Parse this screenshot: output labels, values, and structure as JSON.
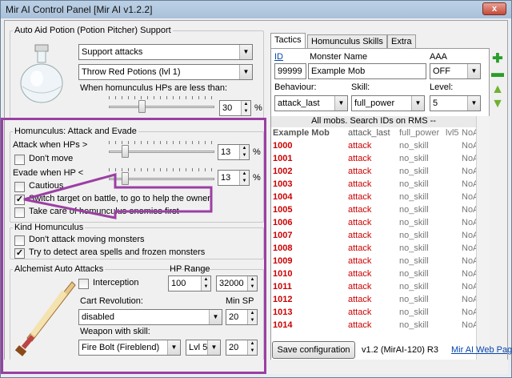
{
  "window": {
    "title": "Mir AI Control Panel [Mir AI v1.2.2]",
    "close": "x"
  },
  "potion": {
    "legend": "Auto Aid Potion (Potion Pitcher) Support",
    "mode": "Support attacks",
    "potion": "Throw Red Potions (lvl 1)",
    "hp_label": "When homunculus HPs are less than:",
    "hp_value": "30",
    "hp_unit": "%",
    "hp_slider_fraction": 0.3
  },
  "attack_evade": {
    "legend": "Homunculus: Attack and Evade",
    "attack_label": "Attack when HPs >",
    "attack_value": "13",
    "attack_unit": "%",
    "attack_slider_fraction": 0.13,
    "dont_move": "Don't move",
    "dont_move_checked": false,
    "evade_label": "Evade when HP <",
    "evade_value": "13",
    "evade_unit": "%",
    "evade_slider_fraction": 0.13,
    "cautious": "Cautious",
    "cautious_checked": false,
    "switch_target": "Switch target on battle, to go to help the owner",
    "switch_target_checked": true,
    "take_care": "Take care of homunculus enemies first",
    "take_care_checked": false
  },
  "kind": {
    "legend": "Kind Homunculus",
    "dont_attack": "Don't attack moving monsters",
    "dont_attack_checked": false,
    "detect_area": "Try to detect area spells and frozen monsters",
    "detect_area_checked": true
  },
  "alchemist": {
    "legend": "Alchemist Auto Attacks",
    "interception": "Interception",
    "interception_checked": false,
    "hp_range_label": "HP Range",
    "hp_min": "100",
    "hp_max": "32000",
    "cart_label": "Cart Revolution:",
    "cart_value": "disabled",
    "min_sp_label": "Min SP",
    "cart_min_sp": "20",
    "weapon_label": "Weapon with skill:",
    "weapon_value": "Fire Bolt (Fireblend)",
    "weapon_level": "Lvl 5",
    "weapon_min_sp": "20"
  },
  "tabs": [
    {
      "label": "Tactics"
    },
    {
      "label": "Homunculus Skills"
    },
    {
      "label": "Extra"
    }
  ],
  "tactics": {
    "id_label": "ID",
    "name_label": "Monster Name",
    "aaa_label": "AAA",
    "id_value": "99999",
    "name_value": "Example Mob",
    "aaa_value": "OFF",
    "behaviour_label": "Behaviour:",
    "skill_label": "Skill:",
    "level_label": "Level:",
    "behaviour_value": "attack_last",
    "skill_value": "full_power",
    "level_value": "5",
    "list_caption": "All mobs. Search IDs on RMS --",
    "header_row": {
      "name": "Example Mob",
      "behaviour": "attack_last",
      "skill": "full_power",
      "level": "lvl5",
      "aaa": "NoAAA"
    },
    "rows": [
      {
        "id": "1000",
        "behaviour": "attack",
        "skill": "no_skill",
        "aaa": "NoAAA"
      },
      {
        "id": "1001",
        "behaviour": "attack",
        "skill": "no_skill",
        "aaa": "NoAAA"
      },
      {
        "id": "1002",
        "behaviour": "attack",
        "skill": "no_skill",
        "aaa": "NoAAA"
      },
      {
        "id": "1003",
        "behaviour": "attack",
        "skill": "no_skill",
        "aaa": "NoAAA"
      },
      {
        "id": "1004",
        "behaviour": "attack",
        "skill": "no_skill",
        "aaa": "NoAAA"
      },
      {
        "id": "1005",
        "behaviour": "attack",
        "skill": "no_skill",
        "aaa": "NoAAA"
      },
      {
        "id": "1006",
        "behaviour": "attack",
        "skill": "no_skill",
        "aaa": "NoAAA"
      },
      {
        "id": "1007",
        "behaviour": "attack",
        "skill": "no_skill",
        "aaa": "NoAAA"
      },
      {
        "id": "1008",
        "behaviour": "attack",
        "skill": "no_skill",
        "aaa": "NoAAA"
      },
      {
        "id": "1009",
        "behaviour": "attack",
        "skill": "no_skill",
        "aaa": "NoAAA"
      },
      {
        "id": "1010",
        "behaviour": "attack",
        "skill": "no_skill",
        "aaa": "NoAAA"
      },
      {
        "id": "1011",
        "behaviour": "attack",
        "skill": "no_skill",
        "aaa": "NoAAA"
      },
      {
        "id": "1012",
        "behaviour": "attack",
        "skill": "no_skill",
        "aaa": "NoAAA"
      },
      {
        "id": "1013",
        "behaviour": "attack",
        "skill": "no_skill",
        "aaa": "NoAAA"
      },
      {
        "id": "1014",
        "behaviour": "attack",
        "skill": "no_skill",
        "aaa": "NoAAA"
      }
    ]
  },
  "footer": {
    "save_label": "Save configuration",
    "version": "v1.2 (MirAI-120) R3",
    "web_link": "Mir AI Web Page"
  },
  "colors": {
    "highlight": "#9b3fa3",
    "id_red": "#cc0000",
    "link": "#0645ad",
    "add_green": "#2a9d2a"
  }
}
